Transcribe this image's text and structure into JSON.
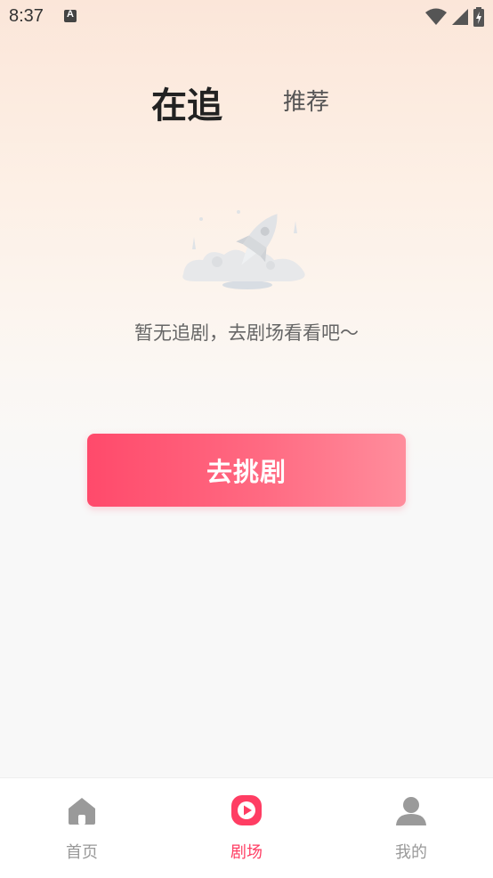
{
  "status_bar": {
    "time": "8:37",
    "icons": [
      "notification-a-icon",
      "wifi-icon",
      "signal-icon",
      "battery-charging-icon"
    ]
  },
  "tabs": [
    {
      "label": "在追",
      "active": true
    },
    {
      "label": "推荐",
      "active": false
    }
  ],
  "empty_state": {
    "illustration": "rocket-illustration",
    "message": "暂无追剧，去剧场看看吧～"
  },
  "cta": {
    "label": "去挑剧"
  },
  "bottom_nav": {
    "items": [
      {
        "label": "首页",
        "icon": "home-icon",
        "active": false
      },
      {
        "label": "剧场",
        "icon": "play-icon",
        "active": true
      },
      {
        "label": "我的",
        "icon": "user-icon",
        "active": false
      }
    ]
  },
  "colors": {
    "accent": "#ff3d63",
    "inactive": "#999999",
    "button_gradient_start": "#ff4a6b",
    "button_gradient_end": "#ff8d9c"
  }
}
